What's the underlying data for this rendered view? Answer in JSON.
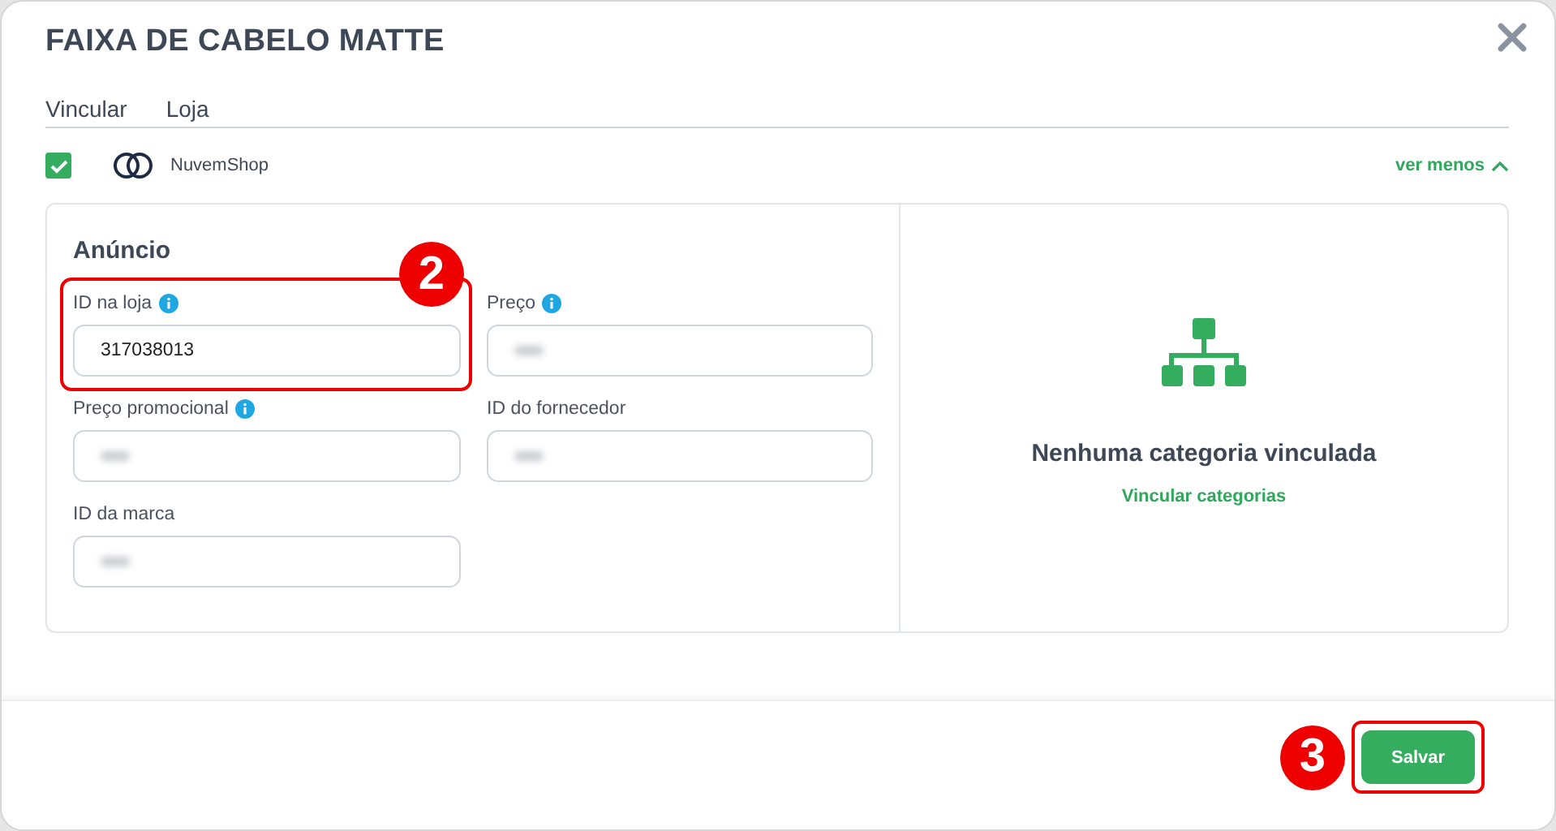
{
  "window": {
    "title": "FAIXA DE CABELO MATTE"
  },
  "columns": [
    "Vincular",
    "Loja"
  ],
  "store": {
    "checked": true,
    "name": "NuvemShop",
    "toggle": "ver menos",
    "expanded": true
  },
  "listing": {
    "heading": "Anúncio",
    "fields": [
      {
        "label": "ID na loja",
        "info": true,
        "value": "317038013",
        "blurred": false,
        "callout": "2"
      },
      {
        "label": "Preço",
        "info": true,
        "blurred": true
      },
      {
        "label": "Preço promocional",
        "info": true,
        "blurred": true
      },
      {
        "label": "ID do fornecedor",
        "info": false,
        "blurred": true
      },
      {
        "label": "ID da marca",
        "info": false,
        "blurred": true
      }
    ]
  },
  "categories": {
    "message": "Nenhuma categoria vinculada",
    "link": "Vincular categorias"
  },
  "footer": {
    "button": "Salvar",
    "callout": "3"
  }
}
